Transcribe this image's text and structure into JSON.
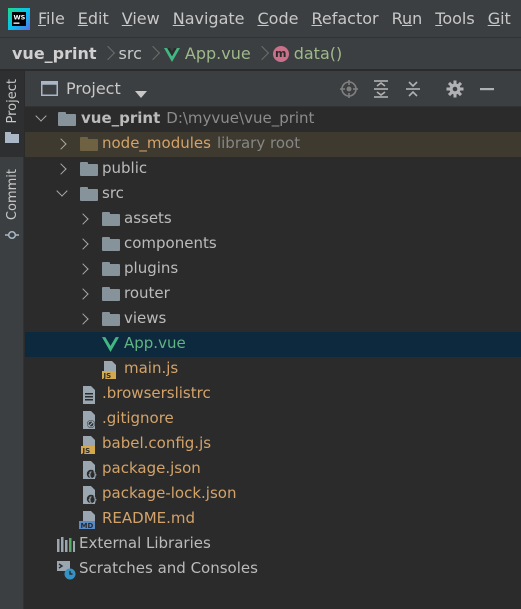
{
  "menu": {
    "items": [
      {
        "pre": "",
        "u": "F",
        "post": "ile"
      },
      {
        "pre": "",
        "u": "E",
        "post": "dit"
      },
      {
        "pre": "",
        "u": "V",
        "post": "iew"
      },
      {
        "pre": "",
        "u": "N",
        "post": "avigate"
      },
      {
        "pre": "",
        "u": "C",
        "post": "ode"
      },
      {
        "pre": "",
        "u": "R",
        "post": "efactor"
      },
      {
        "pre": "R",
        "u": "u",
        "post": "n"
      },
      {
        "pre": "",
        "u": "T",
        "post": "ools"
      },
      {
        "pre": "",
        "u": "G",
        "post": "it"
      }
    ]
  },
  "breadcrumb": {
    "project": "vue_print",
    "folder": "src",
    "file": "App.vue",
    "method_badge": "m",
    "method": "data()"
  },
  "strip": {
    "project_tab": "Project",
    "commit_tab": "Commit"
  },
  "panel": {
    "title": "Project"
  },
  "tree": {
    "root": {
      "name": "vue_print",
      "path": "D:\\myvue\\vue_print"
    },
    "node_modules": {
      "name": "node_modules",
      "hint": "library root"
    },
    "public": "public",
    "src": "src",
    "assets": "assets",
    "components": "components",
    "plugins": "plugins",
    "router": "router",
    "views": "views",
    "app_vue": "App.vue",
    "main_js": "main.js",
    "browserslistrc": ".browserslistrc",
    "gitignore": ".gitignore",
    "babel_config": "babel.config.js",
    "package_json": "package.json",
    "package_lock": "package-lock.json",
    "readme": "README.md",
    "external_libraries": "External Libraries",
    "scratches": "Scratches and Consoles"
  },
  "colors": {
    "background": "#2b2b2b",
    "toolbar": "#3c3f41",
    "selection": "#0d293e",
    "excluded_highlight": "#3e3a2f",
    "vue_green": "#62b383",
    "modified_green": "#6a8759",
    "excluded_orange": "#d3a36a"
  }
}
